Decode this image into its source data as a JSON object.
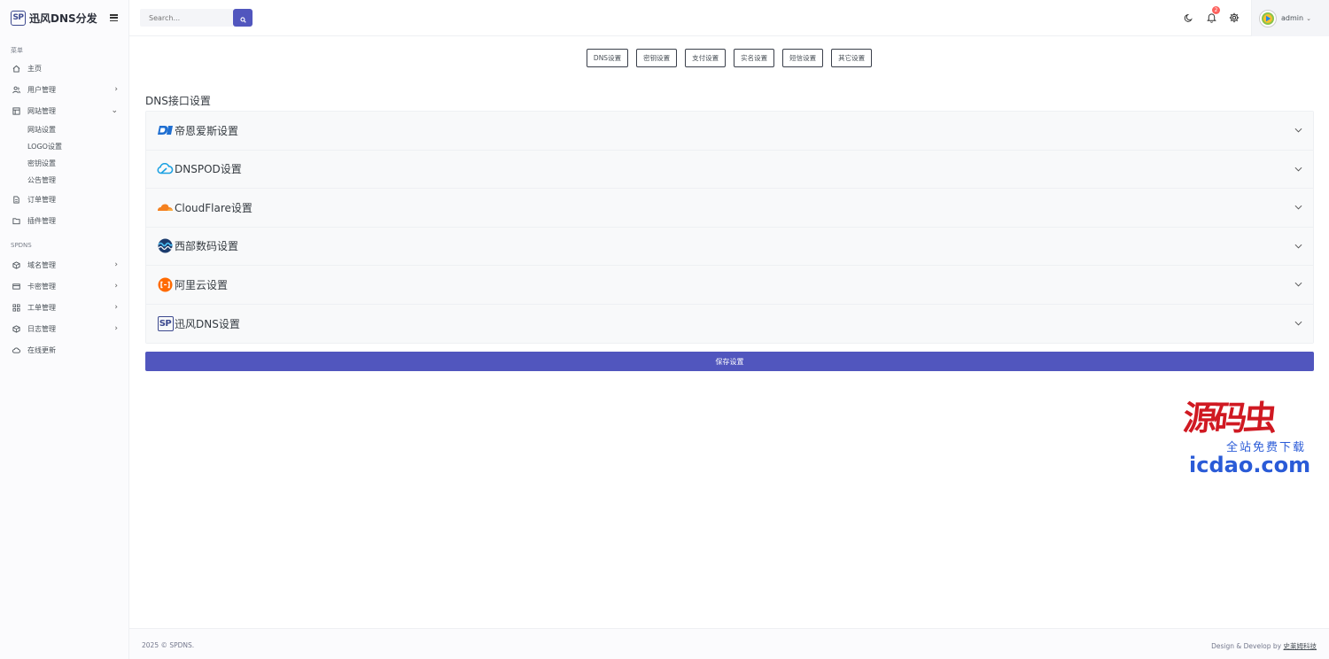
{
  "app": {
    "logo_text": "SP",
    "name": "迅风DNS分发"
  },
  "sidebar": {
    "section_menu": "菜单",
    "menu_items": [
      {
        "label": "主页",
        "icon": "home-icon",
        "chevron": ""
      },
      {
        "label": "用户管理",
        "icon": "users-icon",
        "chevron": "›"
      },
      {
        "label": "网站管理",
        "icon": "layout-icon",
        "chevron": "⌄"
      }
    ],
    "site_sub_items": [
      "网站设置",
      "LOGO设置",
      "密钥设置",
      "公告管理"
    ],
    "menu_items_2": [
      {
        "label": "订单管理",
        "icon": "file-text-icon",
        "chevron": ""
      },
      {
        "label": "插件管理",
        "icon": "folder-icon",
        "chevron": ""
      }
    ],
    "section_spdns": "SPDNS",
    "spdns_items": [
      {
        "label": "域名管理",
        "icon": "globe-icon",
        "chevron": "›"
      },
      {
        "label": "卡密管理",
        "icon": "credit-card-icon",
        "chevron": "›"
      },
      {
        "label": "工单管理",
        "icon": "grid-icon",
        "chevron": "›"
      },
      {
        "label": "日志管理",
        "icon": "box-icon",
        "chevron": "›"
      },
      {
        "label": "在线更新",
        "icon": "cloud-icon",
        "chevron": ""
      }
    ]
  },
  "topbar": {
    "search_placeholder": "Search...",
    "notification_count": "2",
    "user_name": "admin",
    "user_caret": "⌄"
  },
  "tabs": [
    "DNS设置",
    "密钥设置",
    "支付设置",
    "实名设置",
    "短信设置",
    "其它设置"
  ],
  "section_heading": "DNS接口设置",
  "accordion": [
    {
      "title": "帝恩爱斯设置",
      "icon": "dnsla-logo-icon"
    },
    {
      "title": "DNSPOD设置",
      "icon": "dnspod-logo-icon"
    },
    {
      "title": "CloudFlare设置",
      "icon": "cloudflare-logo-icon"
    },
    {
      "title": "西部数码设置",
      "icon": "west-logo-icon"
    },
    {
      "title": "阿里云设置",
      "icon": "aliyun-logo-icon"
    },
    {
      "title": "迅风DNS设置",
      "icon": "spdns-logo-icon",
      "logo_text": "SP"
    }
  ],
  "save_button": "保存设置",
  "watermark": {
    "big": "源码虫",
    "small": "全站免费下载",
    "url": "icdao.com"
  },
  "footer": {
    "left": "2025 © SPDNS.",
    "right_prefix": "Design & Develop by ",
    "right_link": "史莱姆科技"
  },
  "colors": {
    "primary": "#5156be",
    "badge": "#fd625e"
  }
}
